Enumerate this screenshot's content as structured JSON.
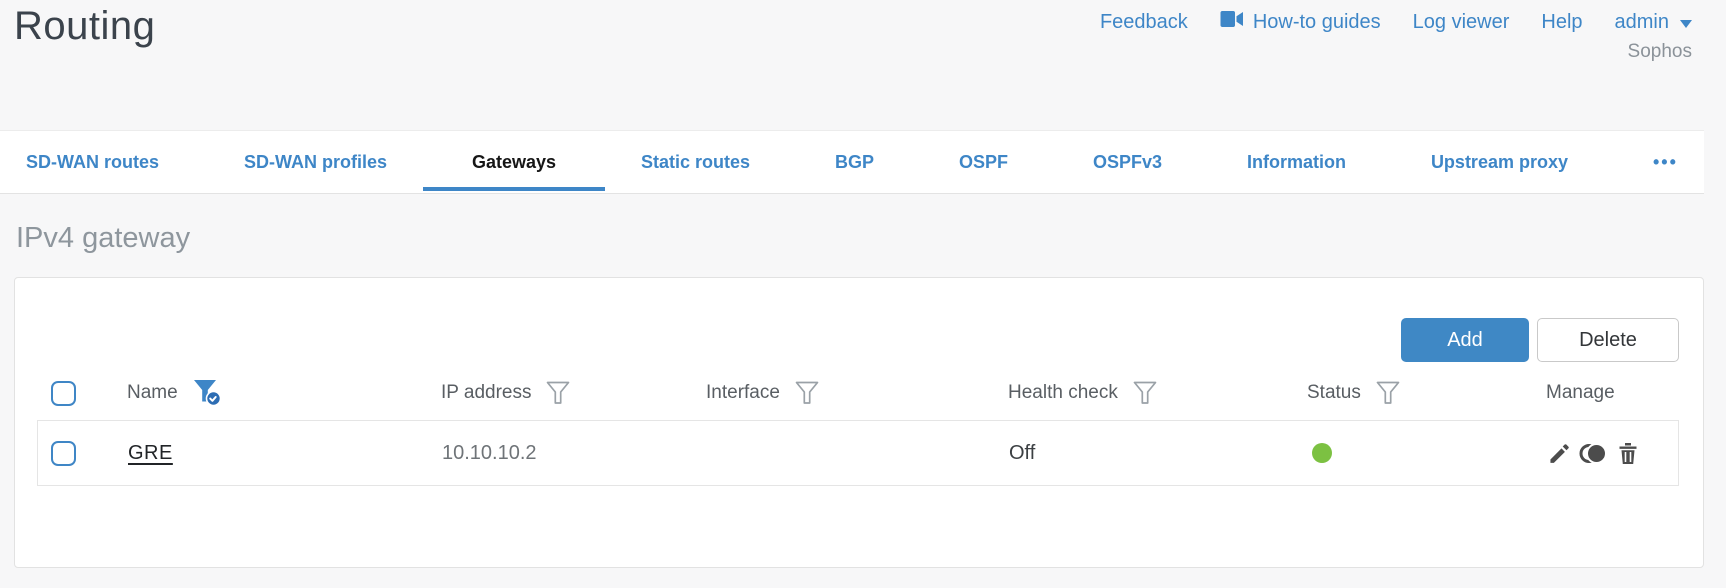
{
  "page": {
    "title": "Routing"
  },
  "top_nav": {
    "feedback": "Feedback",
    "howto_guides": "How-to guides",
    "log_viewer": "Log viewer",
    "help": "Help",
    "user": "admin",
    "brand": "Sophos"
  },
  "tabs": {
    "items": [
      {
        "label": "SD-WAN routes",
        "active": false
      },
      {
        "label": "SD-WAN profiles",
        "active": false
      },
      {
        "label": "Gateways",
        "active": true
      },
      {
        "label": "Static routes",
        "active": false
      },
      {
        "label": "BGP",
        "active": false
      },
      {
        "label": "OSPF",
        "active": false
      },
      {
        "label": "OSPFv3",
        "active": false
      },
      {
        "label": "Information",
        "active": false
      },
      {
        "label": "Upstream proxy",
        "active": false
      }
    ],
    "more": "•••"
  },
  "section": {
    "title": "IPv4 gateway"
  },
  "toolbar": {
    "add_label": "Add",
    "delete_label": "Delete"
  },
  "table": {
    "columns": [
      {
        "label": "Name",
        "filter": "active"
      },
      {
        "label": "IP address",
        "filter": "inactive"
      },
      {
        "label": "Interface",
        "filter": "inactive"
      },
      {
        "label": "Health check",
        "filter": "inactive"
      },
      {
        "label": "Status",
        "filter": "inactive"
      },
      {
        "label": "Manage",
        "filter": "none"
      }
    ],
    "rows": [
      {
        "name": "GRE",
        "ip_address": "10.10.10.2",
        "interface": "",
        "health_check": "Off",
        "status": "green"
      }
    ]
  },
  "colors": {
    "accent_blue": "#3e86c7",
    "status_green": "#7cc142",
    "active_tab_text": "#161616",
    "panel_border": "#e2e2e2"
  }
}
